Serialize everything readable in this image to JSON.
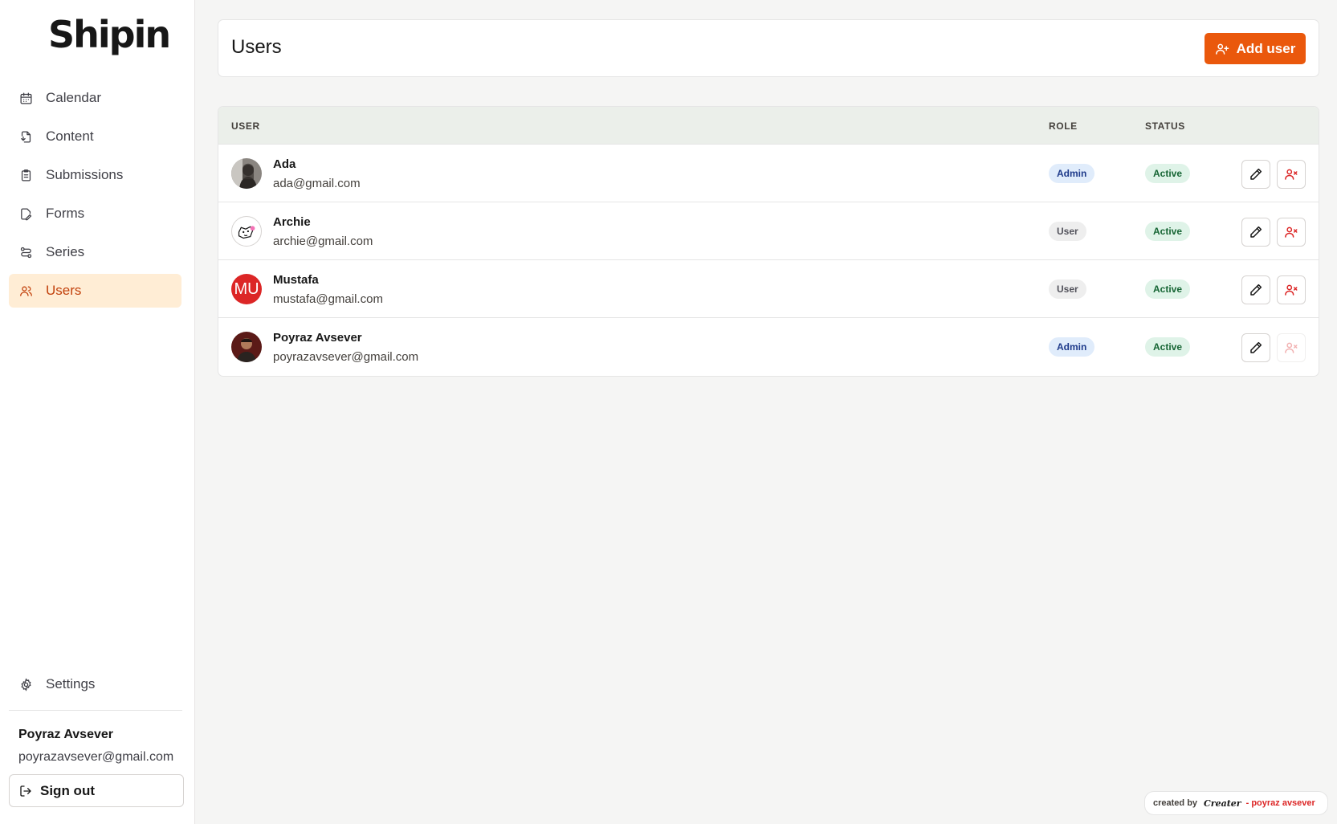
{
  "app": {
    "logo": "Shipin"
  },
  "sidebar": {
    "items": [
      {
        "label": "Calendar",
        "icon": "calendar-icon",
        "active": false
      },
      {
        "label": "Content",
        "icon": "file-icon",
        "active": false
      },
      {
        "label": "Submissions",
        "icon": "clipboard-icon",
        "active": false
      },
      {
        "label": "Forms",
        "icon": "form-edit-icon",
        "active": false
      },
      {
        "label": "Series",
        "icon": "series-icon",
        "active": false
      },
      {
        "label": "Users",
        "icon": "users-icon",
        "active": true
      }
    ],
    "settings_label": "Settings",
    "profile": {
      "name": "Poyraz Avsever",
      "email": "poyrazavsever@gmail.com"
    },
    "signout_label": "Sign out"
  },
  "header": {
    "title": "Users",
    "add_button_label": "Add user"
  },
  "table": {
    "columns": {
      "user": "USER",
      "role": "ROLE",
      "status": "STATUS"
    },
    "rows": [
      {
        "name": "Ada",
        "email": "ada@gmail.com",
        "role": "Admin",
        "status": "Active",
        "avatar": "photo",
        "remove_enabled": true
      },
      {
        "name": "Archie",
        "email": "archie@gmail.com",
        "role": "User",
        "status": "Active",
        "avatar": "illustration",
        "remove_enabled": true
      },
      {
        "name": "Mustafa",
        "email": "mustafa@gmail.com",
        "role": "User",
        "status": "Active",
        "avatar": "initials",
        "initials": "MU",
        "remove_enabled": true
      },
      {
        "name": "Poyraz Avsever",
        "email": "poyrazavsever@gmail.com",
        "role": "Admin",
        "status": "Active",
        "avatar": "photo",
        "remove_enabled": false
      }
    ]
  },
  "credit": {
    "prefix": "created by",
    "brand": "Creater",
    "suffix": "- poyraz avsever"
  },
  "colors": {
    "accent": "#ea580c",
    "active_nav_bg": "#ffedd5",
    "active_nav_text": "#c2410c",
    "danger": "#dc2626"
  }
}
